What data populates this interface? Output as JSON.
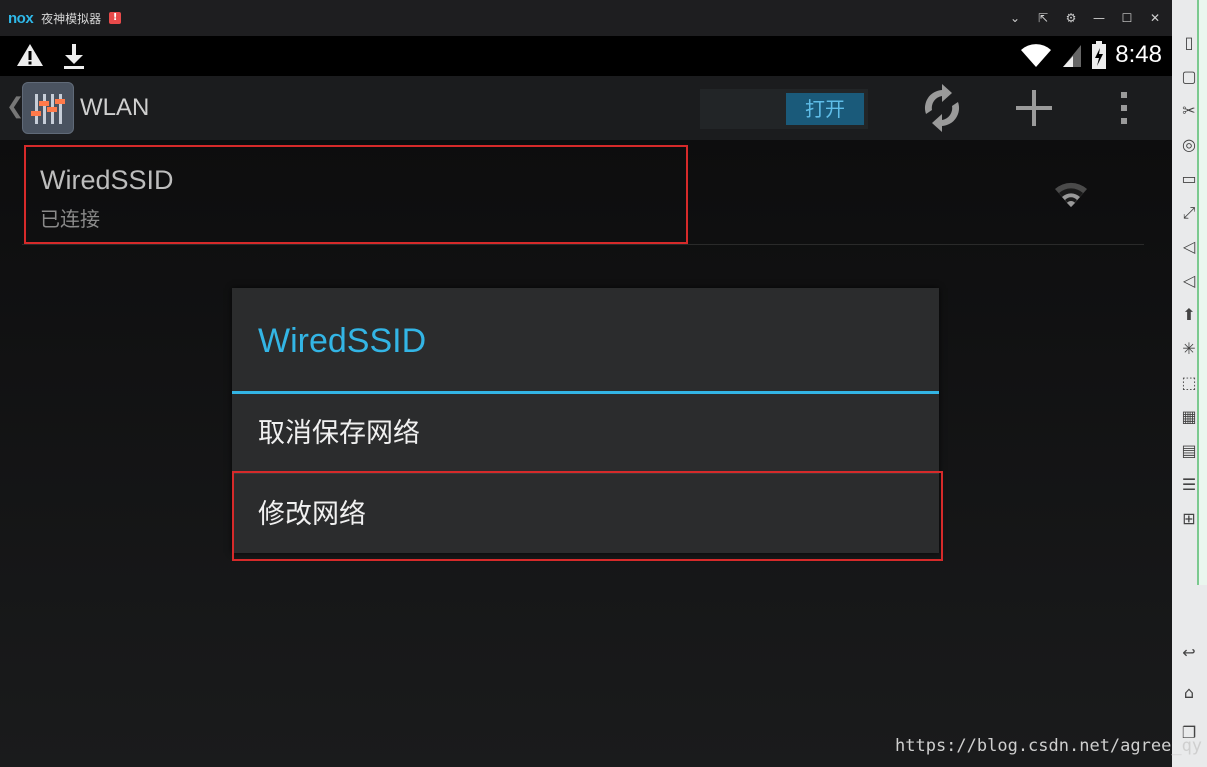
{
  "titlebar": {
    "logo": "nox",
    "title": "夜神模拟器",
    "badge": "!",
    "controls": [
      "⌄",
      "⇱",
      "⚙",
      "—",
      "☐",
      "✕"
    ]
  },
  "statusbar": {
    "left_icons": [
      "warning-icon",
      "download-icon"
    ],
    "time": "8:48"
  },
  "actionbar": {
    "back_glyph": "❮",
    "title": "WLAN",
    "toggle_label": "打开"
  },
  "wifi": {
    "ssid": "WiredSSID",
    "status": "已连接"
  },
  "dialog": {
    "title": "WiredSSID",
    "items": [
      "取消保存网络",
      "修改网络"
    ]
  },
  "sidebar": {
    "tools": [
      "phone-icon",
      "screenshot-icon",
      "scissors-icon",
      "location-icon",
      "screen-icon",
      "fullscreen-icon",
      "volume-up-icon",
      "volume-down-icon",
      "apk-icon",
      "shake-icon",
      "macro-icon",
      "multi-instance-icon",
      "layers-icon",
      "menu-icon",
      "plus-icon"
    ],
    "nav": [
      "back-icon",
      "home-icon",
      "recent-icon"
    ]
  },
  "watermark": "https://blog.csdn.net/agree_qy",
  "colors": {
    "accent": "#33b5e5",
    "highlight": "#d62a2a",
    "toggle_bg": "#1a5a7a"
  }
}
